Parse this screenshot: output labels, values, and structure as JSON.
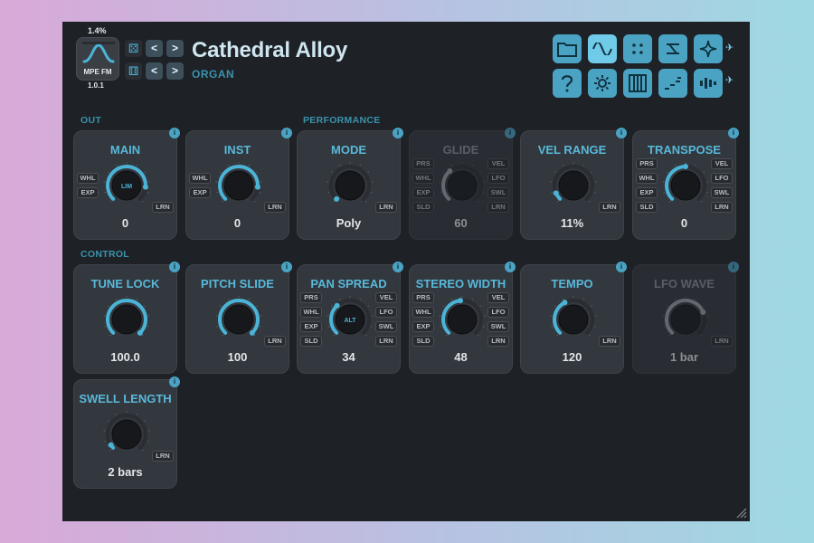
{
  "header": {
    "usage": "1.4%",
    "logo_text": "MPE FM",
    "version": "1.0.1",
    "preset_name": "Cathedral Alloy",
    "preset_category": "ORGAN",
    "nav_prev": "<",
    "nav_next": ">"
  },
  "toolbar": [
    {
      "name": "browser-folder-icon",
      "active": false
    },
    {
      "name": "oscillator-sine-icon",
      "active": true
    },
    {
      "name": "grid-dots-icon",
      "active": false
    },
    {
      "name": "routing-icon",
      "active": false
    },
    {
      "name": "effects-sparkle-icon",
      "active": false
    },
    {
      "name": "help-question-icon",
      "active": false
    },
    {
      "name": "settings-gear-icon",
      "active": false
    },
    {
      "name": "keyboard-icon",
      "active": false
    },
    {
      "name": "steps-icon",
      "active": false
    },
    {
      "name": "mixer-bars-icon",
      "active": false
    }
  ],
  "sections": {
    "out": "OUT",
    "performance": "PERFORMANCE",
    "control": "CONTROL"
  },
  "tags": {
    "whl": "WHL",
    "exp": "EXP",
    "lrn": "LRN",
    "prs": "PRS",
    "sld": "SLD",
    "vel": "VEL",
    "lfo": "LFO",
    "swl": "SWL",
    "info": "i"
  },
  "knobs": {
    "main": {
      "title": "MAIN",
      "value": "0",
      "inner": "LIM",
      "level": 0.85
    },
    "inst": {
      "title": "INST",
      "value": "0",
      "level": 0.85
    },
    "mode": {
      "title": "MODE",
      "value": "Poly",
      "level": 0.0
    },
    "glide": {
      "title": "GLIDE",
      "value": "60",
      "level": 0.35
    },
    "vel_range": {
      "title": "VEL RANGE",
      "value": "11%",
      "level": 0.08
    },
    "transpose": {
      "title": "TRANSPOSE",
      "value": "0",
      "level": 0.5
    },
    "tune_lock": {
      "title": "TUNE LOCK",
      "value": "100.0",
      "level": 1.0
    },
    "pitch_slide": {
      "title": "PITCH SLIDE",
      "value": "100",
      "level": 1.0
    },
    "pan_spread": {
      "title": "PAN SPREAD",
      "value": "34",
      "inner": "ALT",
      "level": 0.34
    },
    "stereo_width": {
      "title": "STEREO WIDTH",
      "value": "48",
      "level": 0.48
    },
    "tempo": {
      "title": "TEMPO",
      "value": "120",
      "level": 0.4
    },
    "lfo_wave": {
      "title": "LFO WAVE",
      "value": "1 bar",
      "level": 0.75
    },
    "swell_length": {
      "title": "SWELL LENGTH",
      "value": "2 bars",
      "level": 0.04
    }
  },
  "colors": {
    "accent": "#4bb4d6",
    "accent_dim": "#3a93ad",
    "panel": "#1e2126",
    "card": "#33373e"
  }
}
